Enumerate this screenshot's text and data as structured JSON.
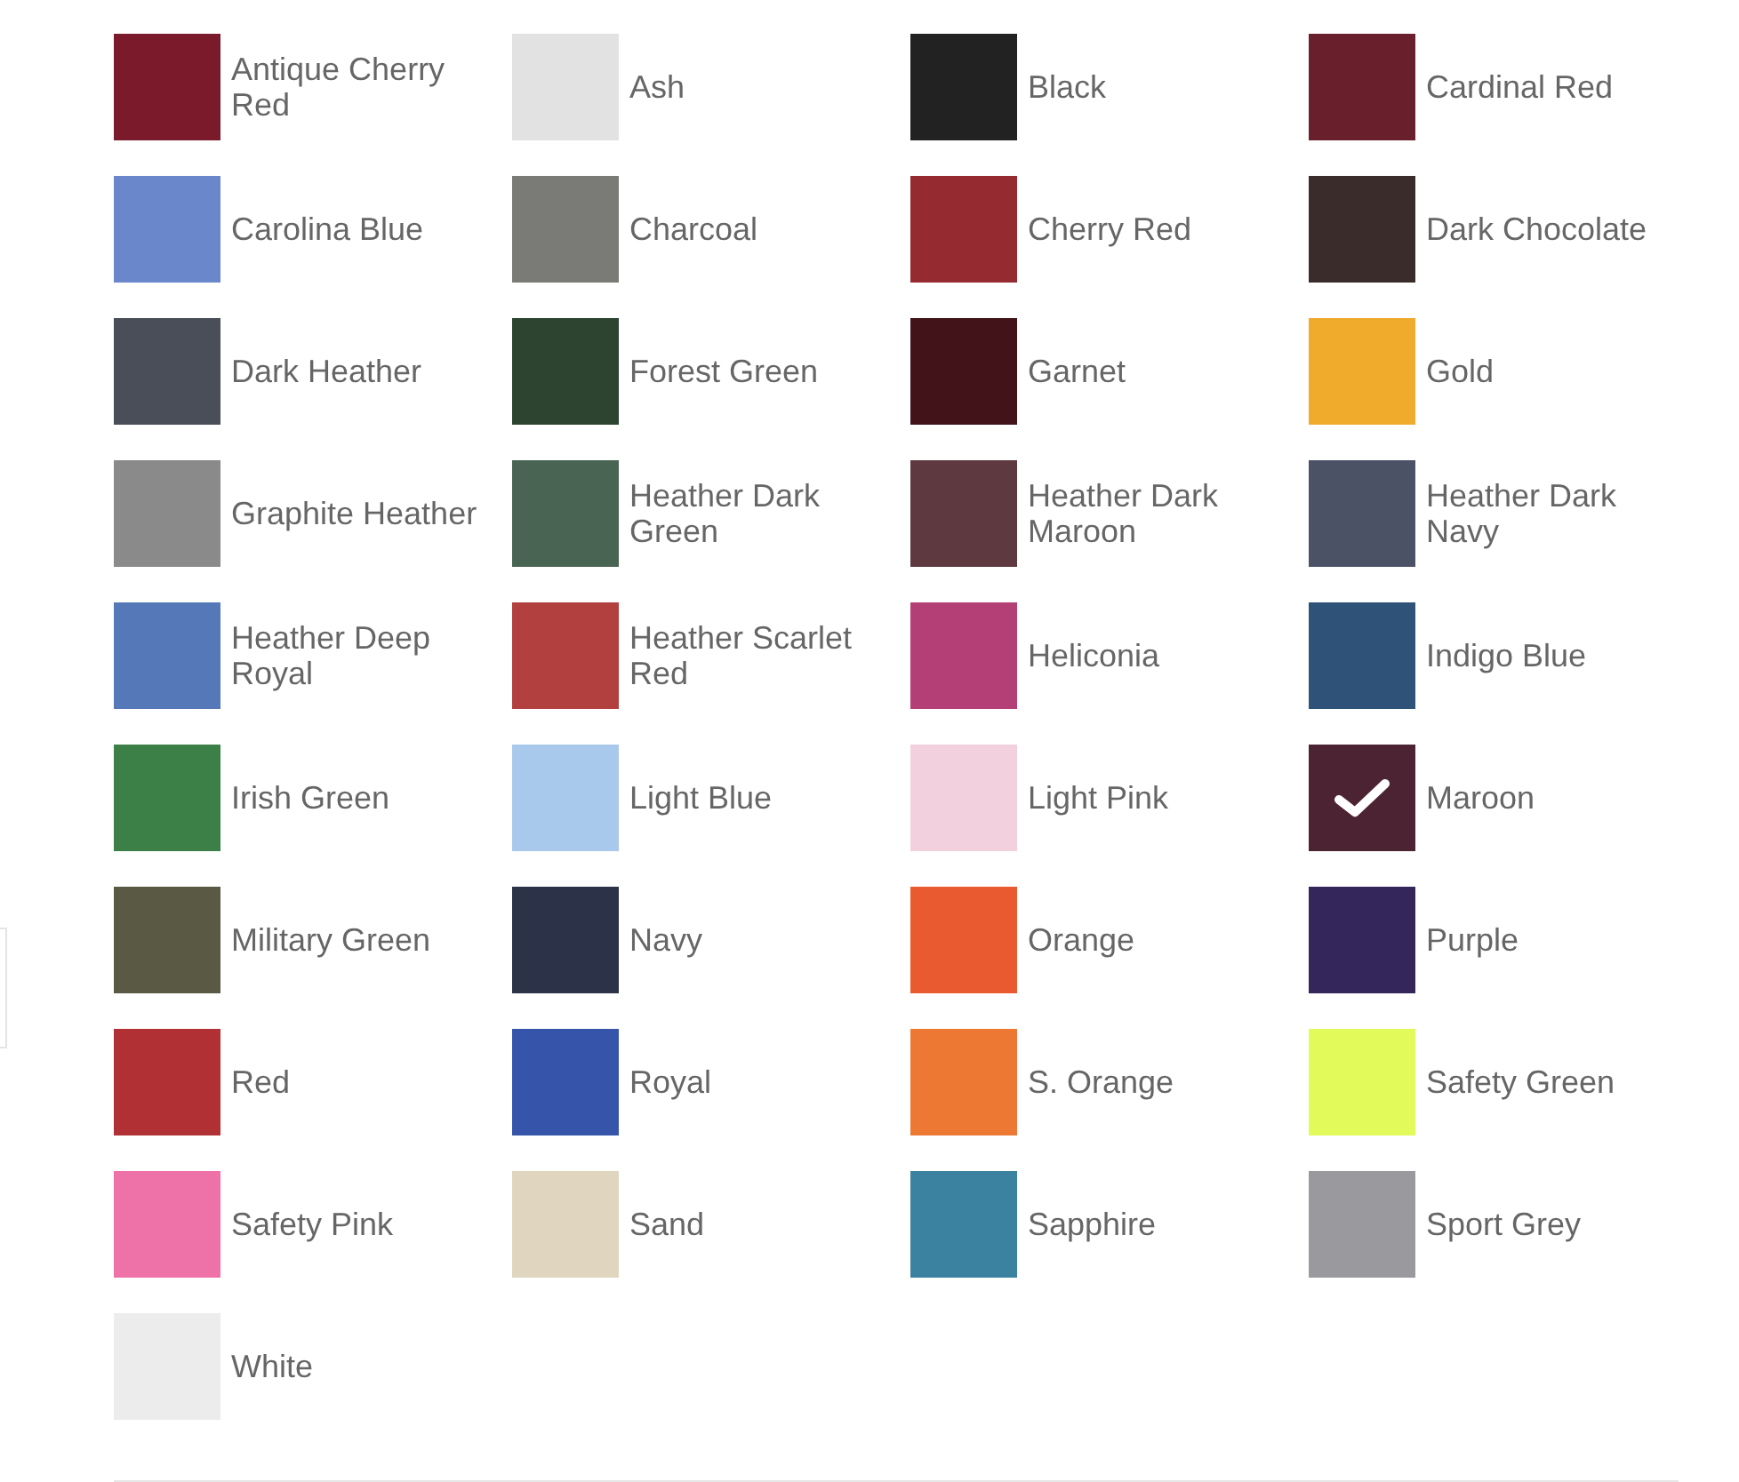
{
  "swatches": [
    {
      "label": "Antique Cherry Red",
      "color": "#7a1a2a",
      "selected": false
    },
    {
      "label": "Ash",
      "color": "#e2e2e2",
      "selected": false
    },
    {
      "label": "Black",
      "color": "#222222",
      "selected": false
    },
    {
      "label": "Cardinal Red",
      "color": "#6a1f2c",
      "selected": false
    },
    {
      "label": "Carolina Blue",
      "color": "#6b87cc",
      "selected": false
    },
    {
      "label": "Charcoal",
      "color": "#7a7a76",
      "selected": false
    },
    {
      "label": "Cherry Red",
      "color": "#962a31",
      "selected": false
    },
    {
      "label": "Dark Chocolate",
      "color": "#3a2c2a",
      "selected": false
    },
    {
      "label": "Dark Heather",
      "color": "#4a4e58",
      "selected": false
    },
    {
      "label": "Forest Green",
      "color": "#2c4430",
      "selected": false
    },
    {
      "label": "Garnet",
      "color": "#42141a",
      "selected": false
    },
    {
      "label": "Gold",
      "color": "#f0aa2c",
      "selected": false
    },
    {
      "label": "Graphite Heather",
      "color": "#8a8a8a",
      "selected": false
    },
    {
      "label": "Heather Dark Green",
      "color": "#4a6454",
      "selected": false
    },
    {
      "label": "Heather Dark Maroon",
      "color": "#5e3a40",
      "selected": false
    },
    {
      "label": "Heather Dark Navy",
      "color": "#4c5266",
      "selected": false
    },
    {
      "label": "Heather Deep Royal",
      "color": "#5478b8",
      "selected": false
    },
    {
      "label": "Heather Scarlet Red",
      "color": "#b2403e",
      "selected": false
    },
    {
      "label": "Heliconia",
      "color": "#b43e76",
      "selected": false
    },
    {
      "label": "Indigo Blue",
      "color": "#2e5278",
      "selected": false
    },
    {
      "label": "Irish Green",
      "color": "#3c8048",
      "selected": false
    },
    {
      "label": "Light Blue",
      "color": "#a8c8ec",
      "selected": false
    },
    {
      "label": "Light Pink",
      "color": "#f2d0de",
      "selected": false
    },
    {
      "label": "Maroon",
      "color": "#4c2332",
      "selected": true
    },
    {
      "label": "Military Green",
      "color": "#5a5a44",
      "selected": false
    },
    {
      "label": "Navy",
      "color": "#2c3248",
      "selected": false
    },
    {
      "label": "Orange",
      "color": "#ea5a30",
      "selected": false
    },
    {
      "label": "Purple",
      "color": "#34265a",
      "selected": false
    },
    {
      "label": "Red",
      "color": "#b03034",
      "selected": false
    },
    {
      "label": "Royal",
      "color": "#3654aa",
      "selected": false
    },
    {
      "label": "S. Orange",
      "color": "#ec7834",
      "selected": false
    },
    {
      "label": "Safety Green",
      "color": "#e2fa5a",
      "selected": false
    },
    {
      "label": "Safety Pink",
      "color": "#ee72a8",
      "selected": false
    },
    {
      "label": "Sand",
      "color": "#e0d6c0",
      "selected": false
    },
    {
      "label": "Sapphire",
      "color": "#3a82a0",
      "selected": false
    },
    {
      "label": "Sport Grey",
      "color": "#9a9a9e",
      "selected": false
    },
    {
      "label": "White",
      "color": "#ececec",
      "selected": false
    }
  ]
}
